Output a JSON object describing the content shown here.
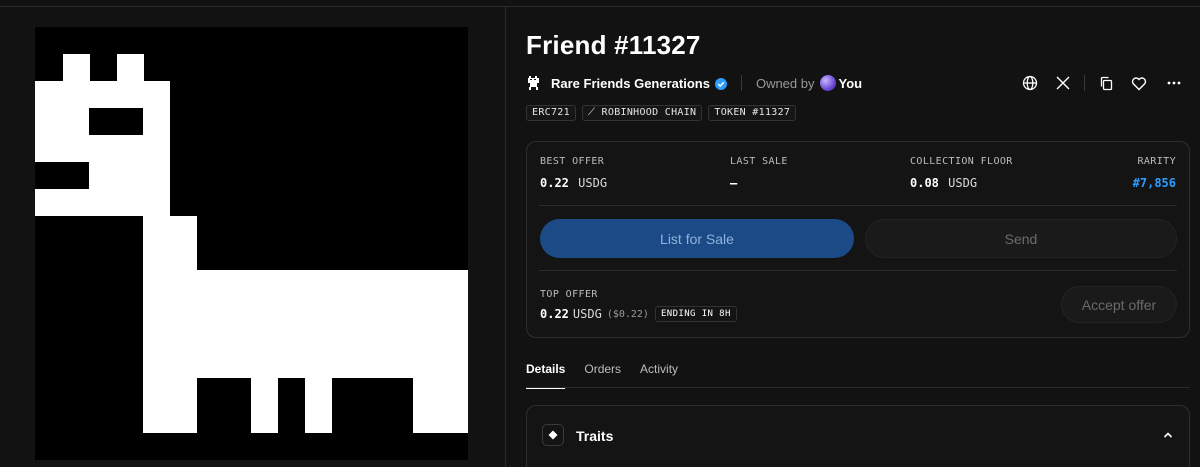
{
  "nft": {
    "title": "Friend #11327",
    "collection_name": "Rare Friends Generations",
    "owned_by_label": "Owned by",
    "owner_name": "You"
  },
  "icons": {
    "collection": "pixel-creature-icon",
    "verified": "verified-badge-icon",
    "owner_avatar": "avatar-icon",
    "website": "globe-icon",
    "x": "x-icon",
    "copy": "copy-icon",
    "favorite": "heart-icon",
    "more": "more-icon",
    "traits": "diamond-icon",
    "collapse": "chevron-up-icon"
  },
  "tags": [
    "ERC721",
    "⟋ ROBINHOOD CHAIN",
    "TOKEN #11327"
  ],
  "stats": {
    "best_offer": {
      "label": "BEST OFFER",
      "value": "0.22",
      "unit": "USDG"
    },
    "last_sale": {
      "label": "LAST SALE",
      "value": "—"
    },
    "collection_floor": {
      "label": "COLLECTION FLOOR",
      "value": "0.08",
      "unit": "USDG"
    },
    "rarity": {
      "label": "RARITY",
      "value": "#7,856"
    }
  },
  "buttons": {
    "list_for_sale": "List for Sale",
    "send": "Send",
    "accept_offer": "Accept offer"
  },
  "top_offer": {
    "label": "TOP OFFER",
    "value": "0.22",
    "unit": "USDG",
    "usd": "($0.22)",
    "ending": "ENDING IN 8H"
  },
  "tabs": [
    "Details",
    "Orders",
    "Activity"
  ],
  "traits": {
    "title": "Traits"
  },
  "colors": {
    "background": "#121212",
    "accent_blue": "#2d9cff",
    "primary_button": "#1b4a87"
  }
}
